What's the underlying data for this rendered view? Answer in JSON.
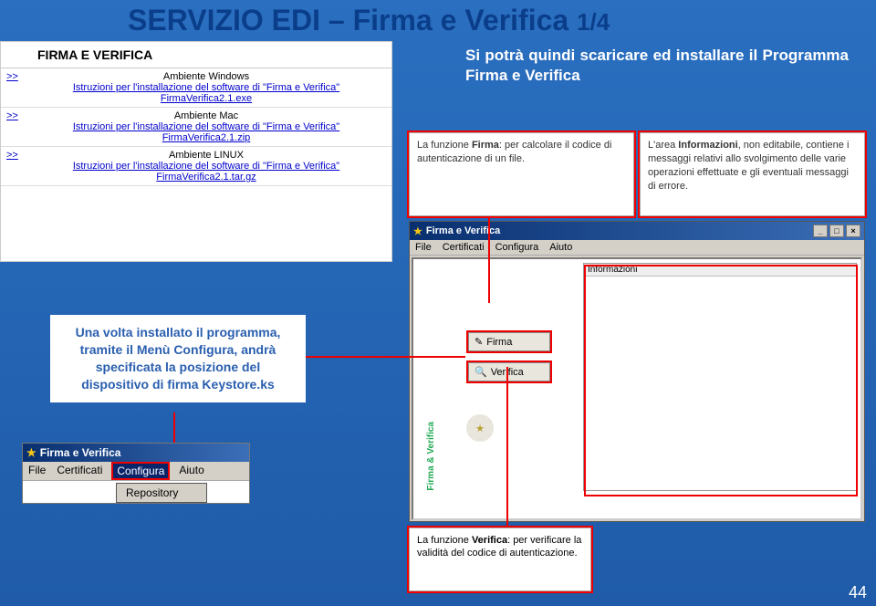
{
  "slide": {
    "title_main": "SERVIZIO EDI – Firma e Verifica ",
    "title_frac": "1/4",
    "intro": "Si potrà quindi scaricare ed installare il Programma Firma e Verifica",
    "page_number": "44"
  },
  "download": {
    "heading": "FIRMA E VERIFICA",
    "arrow": ">>",
    "rows": [
      {
        "env": "Ambiente Windows",
        "link1": "Istruzioni per l'installazione del software di \"Firma e Verifica\"",
        "link2": "FirmaVerifica2.1.exe"
      },
      {
        "env": "Ambiente Mac",
        "link1": "Istruzioni per l'installazione del software di \"Firma e Verifica\"",
        "link2": "FirmaVerifica2.1.zip"
      },
      {
        "env": "Ambiente LINUX",
        "link1": "Istruzioni per l'installazione del software di \"Firma e Verifica\"",
        "link2": "FirmaVerifica2.1.tar.gz"
      }
    ]
  },
  "callouts": {
    "firma_pre": "La funzione ",
    "firma_bold": "Firma",
    "firma_rest": ": per calcolare il codice di autenticazione di un file.",
    "info_pre": "L'area ",
    "info_bold": "Informazioni",
    "info_rest": ", non editabile, contiene i messaggi relativi allo svolgimento delle varie operazioni effettuate e gli eventuali messaggi di errore.",
    "verifica_pre": "La funzione ",
    "verifica_bold": "Verifica",
    "verifica_rest": ": per verificare la validità del codice di autenticazione."
  },
  "app": {
    "title": "Firma e Verifica",
    "menus": [
      "File",
      "Certificati",
      "Configura",
      "Aiuto"
    ],
    "info_header": "Informazioni",
    "btn_firma": "Firma",
    "btn_verifica": "Verifica",
    "vertical_label": "Firma & Verifica"
  },
  "instruct": {
    "text": "Una volta installato il programma, tramite il Menù Configura, andrà specificata la posizione del dispositivo di firma Keystore.ks"
  },
  "cfg": {
    "title": "Firma e Verifica",
    "menus": [
      "File",
      "Certificati",
      "Configura",
      "Aiuto"
    ],
    "dropdown_item": "Repository"
  }
}
